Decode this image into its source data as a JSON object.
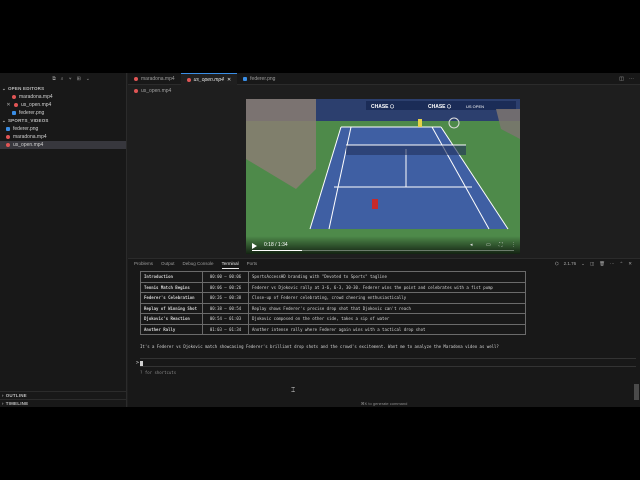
{
  "sidebar": {
    "open_editors_title": "OPEN EDITORS",
    "open_editors": [
      {
        "name": "maradona.mp4",
        "type": "video",
        "active": false
      },
      {
        "name": "us_open.mp4",
        "type": "video",
        "active": false
      },
      {
        "name": "federer.png",
        "type": "image",
        "active": false
      }
    ],
    "folder_title": "SPORTS_VIDEOS",
    "folder_items": [
      {
        "name": "federer.png",
        "type": "image",
        "active": false
      },
      {
        "name": "maradona.mp4",
        "type": "video",
        "active": false
      },
      {
        "name": "us_open.mp4",
        "type": "video",
        "active": true
      }
    ],
    "outline_title": "OUTLINE",
    "timeline_title": "TIMELINE"
  },
  "tabs": [
    {
      "label": "maradona.mp4",
      "type": "video",
      "active": false
    },
    {
      "label": "us_open.mp4",
      "type": "video",
      "active": true
    },
    {
      "label": "federer.png",
      "type": "image",
      "active": false
    }
  ],
  "breadcrumb": "us_open.mp4",
  "video": {
    "time": "0:18 / 1:34",
    "progress": 0.19
  },
  "panel": {
    "tabs": [
      "Problems",
      "Output",
      "Debug Console",
      "Terminal",
      "Ports"
    ],
    "active_tab": "Terminal",
    "right_label": "2.1.76",
    "timeline_rows": [
      {
        "event": "Introduction",
        "time": "00:00 – 00:06",
        "description": "SportsAccessHD branding with \"Devoted to Sports\" tagline"
      },
      {
        "event": "Tennis Match Begins",
        "time": "00:06 – 00:26",
        "description": "Federer vs Djokovic rally at 3-6, 6-3, 30-30. Federer wins the point and celebrates with a fist pump"
      },
      {
        "event": "Federer's Celebration",
        "time": "00:26 – 00:38",
        "description": "Close-up of Federer celebrating, crowd cheering enthusiastically"
      },
      {
        "event": "Replay of Winning Shot",
        "time": "00:38 – 00:54",
        "description": "Replay shows Federer's precise drop shot that Djokovic can't reach"
      },
      {
        "event": "Djokovic's Reaction",
        "time": "00:54 – 01:03",
        "description": "Djokovic composed on the other side, takes a sip of water"
      },
      {
        "event": "Another Rally",
        "time": "01:03 – 01:34",
        "description": "Another intense rally where Federer again wins with a tactical drop shot"
      }
    ],
    "summary": "It's a Federer vs Djokovic match showcasing Federer's brilliant drop shots and the crowd's excitement. Want me to analyze the Maradona video as well?",
    "prompt_symbol": ">",
    "hint": "? for shortcuts"
  },
  "statusbar": "⌘K to generate command",
  "colors": {
    "accent": "#3a8ee6",
    "video_badge": "#e05555",
    "court_green": "#4e8a4a",
    "court_blue": "#3f5fa3"
  }
}
